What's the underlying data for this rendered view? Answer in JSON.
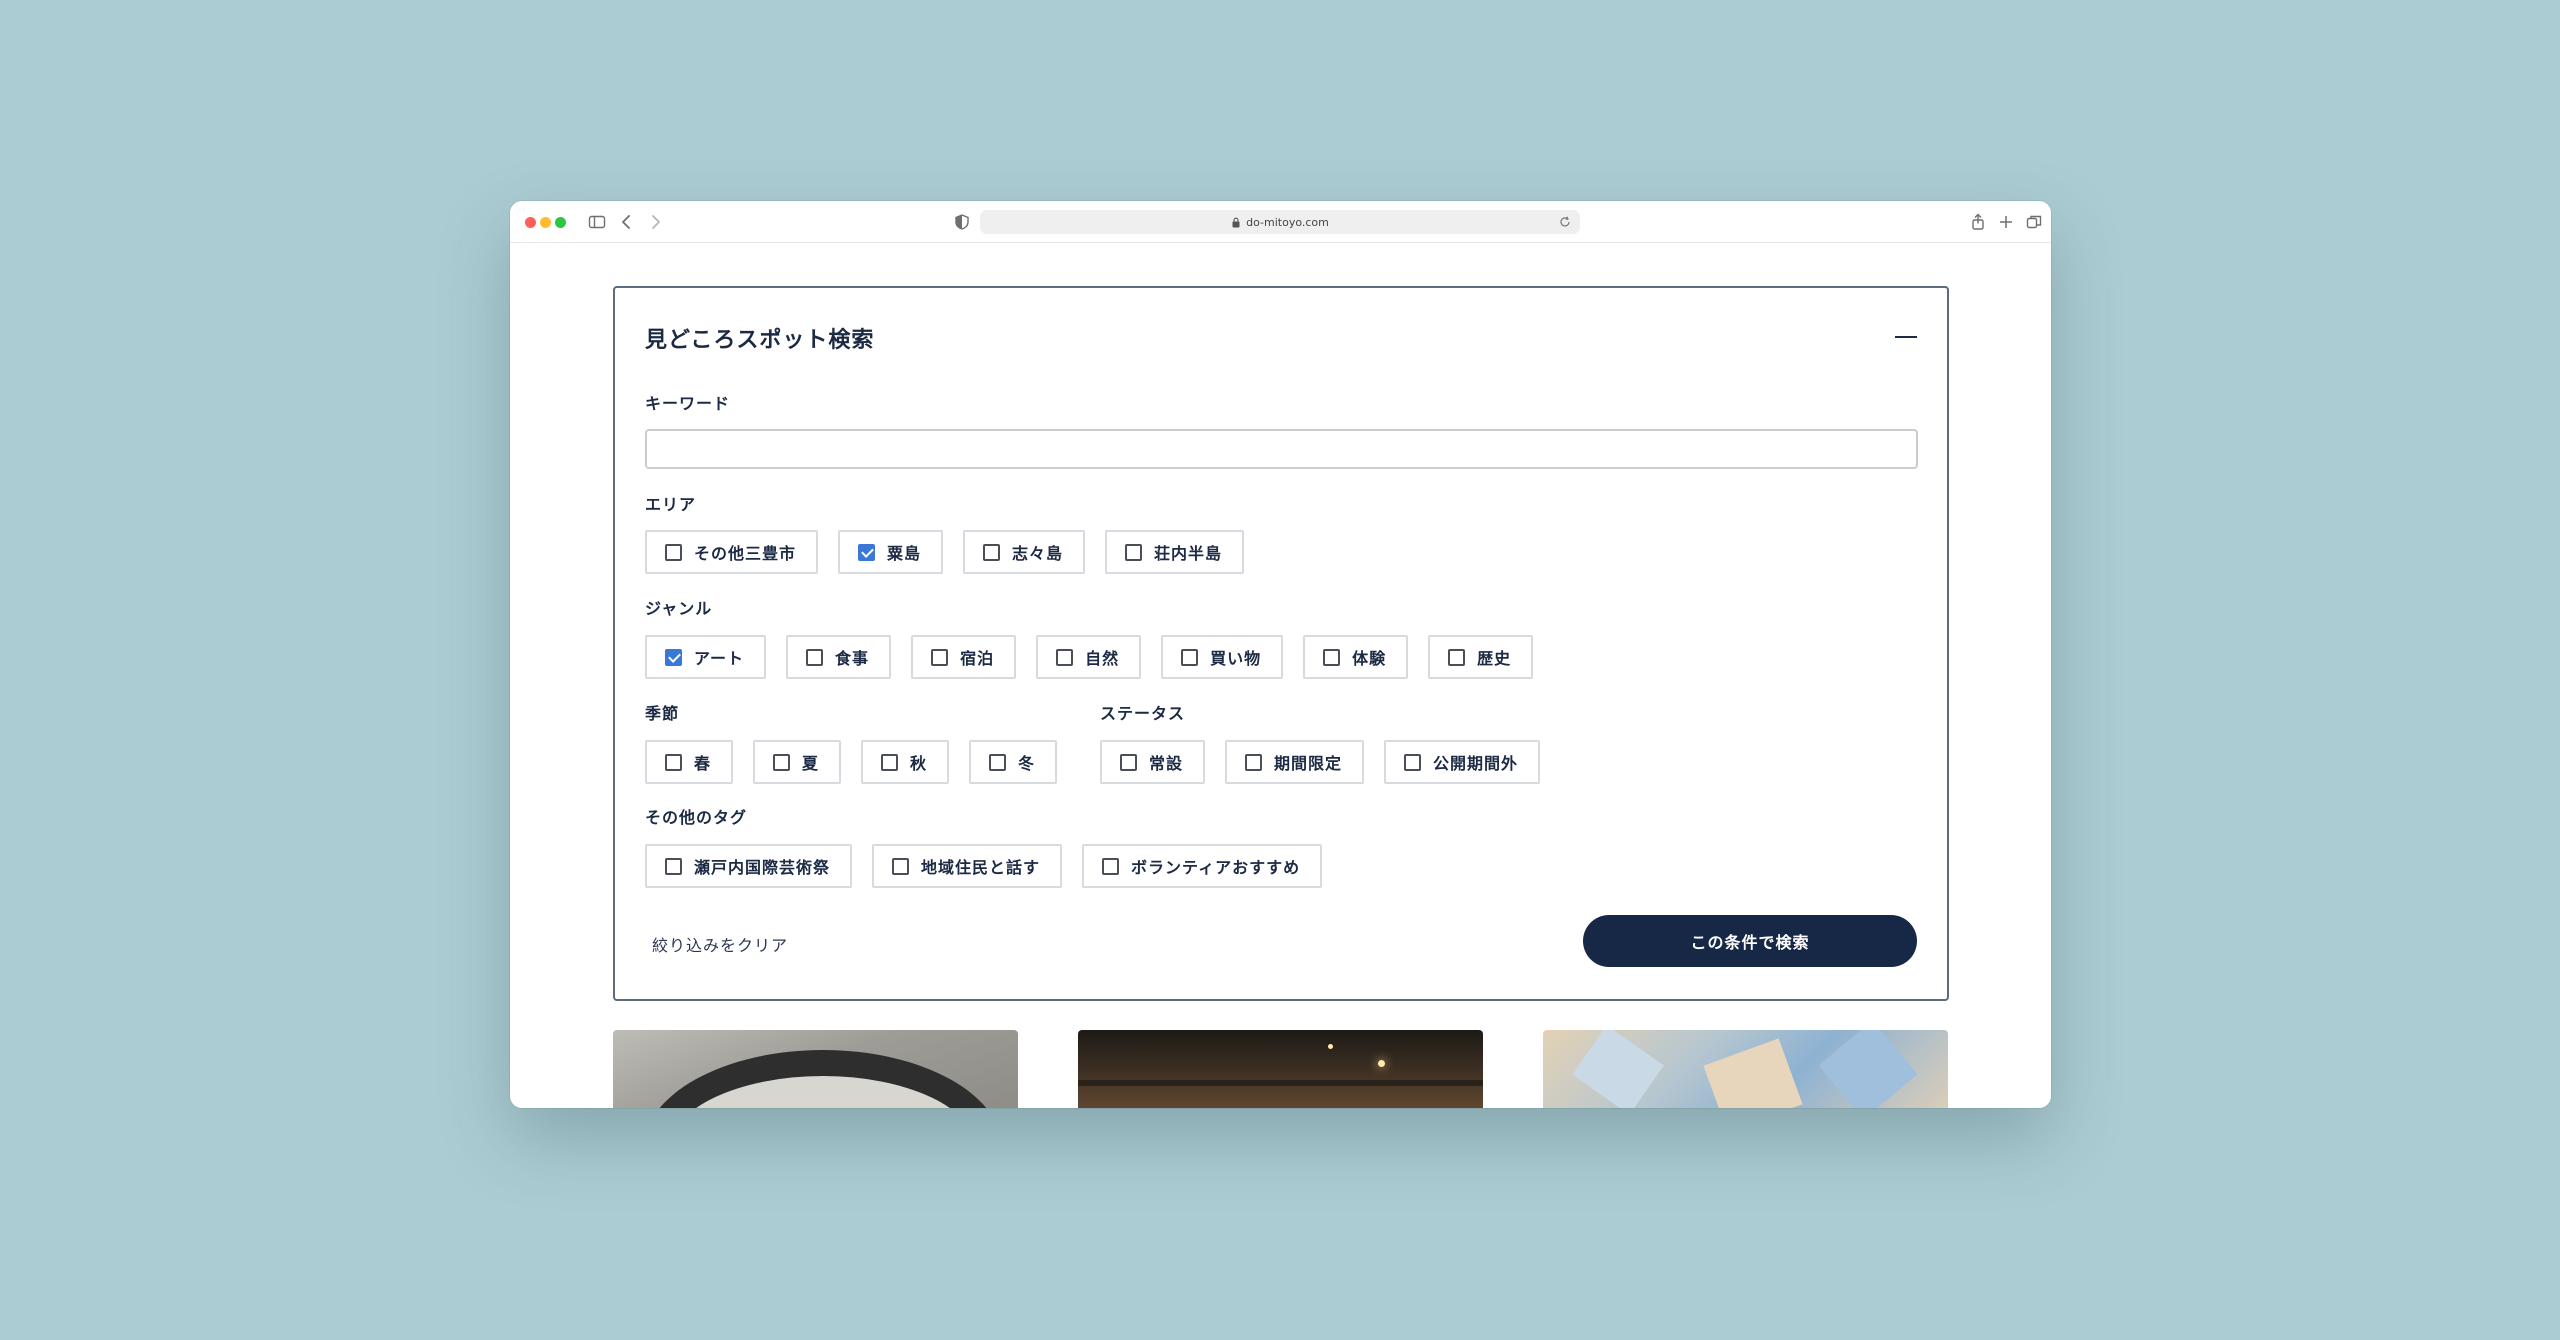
{
  "browser": {
    "url": "do-mitoyo.com"
  },
  "search_panel": {
    "title": "見どころスポット検索",
    "keyword": {
      "label": "キーワード",
      "value": "",
      "placeholder": ""
    },
    "area": {
      "label": "エリア",
      "options": [
        {
          "label": "その他三豊市",
          "checked": false
        },
        {
          "label": "粟島",
          "checked": true
        },
        {
          "label": "志々島",
          "checked": false
        },
        {
          "label": "荘内半島",
          "checked": false
        }
      ]
    },
    "genre": {
      "label": "ジャンル",
      "options": [
        {
          "label": "アート",
          "checked": true
        },
        {
          "label": "食事",
          "checked": false
        },
        {
          "label": "宿泊",
          "checked": false
        },
        {
          "label": "自然",
          "checked": false
        },
        {
          "label": "買い物",
          "checked": false
        },
        {
          "label": "体験",
          "checked": false
        },
        {
          "label": "歴史",
          "checked": false
        }
      ]
    },
    "season": {
      "label": "季節",
      "options": [
        {
          "label": "春",
          "checked": false
        },
        {
          "label": "夏",
          "checked": false
        },
        {
          "label": "秋",
          "checked": false
        },
        {
          "label": "冬",
          "checked": false
        }
      ]
    },
    "status": {
      "label": "ステータス",
      "options": [
        {
          "label": "常設",
          "checked": false
        },
        {
          "label": "期間限定",
          "checked": false
        },
        {
          "label": "公開期間外",
          "checked": false
        }
      ]
    },
    "tags": {
      "label": "その他のタグ",
      "options": [
        {
          "label": "瀬戸内国際芸術祭",
          "checked": false
        },
        {
          "label": "地域住民と話す",
          "checked": false
        },
        {
          "label": "ボランティアおすすめ",
          "checked": false
        }
      ]
    },
    "clear_label": "絞り込みをクリア",
    "search_label": "この条件で検索"
  },
  "colors": {
    "background": "#acccd3",
    "navy": "#172846",
    "check_blue": "#3a78d8"
  }
}
